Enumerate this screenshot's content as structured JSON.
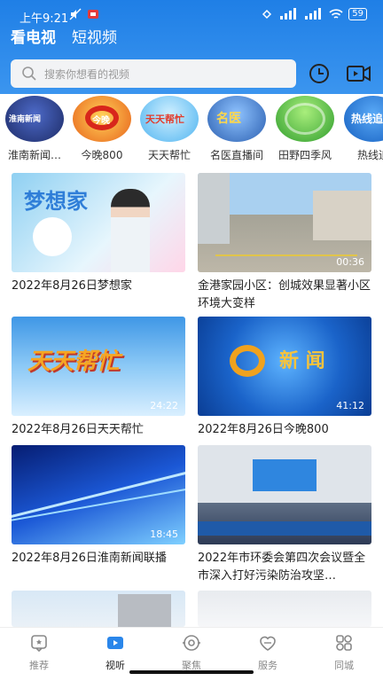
{
  "status_bar": {
    "time": "上午9:21",
    "battery": "59"
  },
  "main_tabs": [
    {
      "label": "看电视",
      "active": true
    },
    {
      "label": "短视频",
      "active": false
    }
  ],
  "search": {
    "placeholder": "搜索你想看的视频",
    "history_icon": "clock-icon",
    "video_icon": "video-camera-icon"
  },
  "channels": [
    {
      "name": "淮南新闻…",
      "logo_text": "淮南新闻",
      "bg": "#2b3a78"
    },
    {
      "name": "今晚800",
      "logo_text": "今晚",
      "bg": "#f07a1d"
    },
    {
      "name": "天天帮忙",
      "logo_text": "天天帮忙",
      "bg": "#4fb4f0"
    },
    {
      "name": "名医直播间",
      "logo_text": "名医",
      "bg": "#3d77c9"
    },
    {
      "name": "田野四季风",
      "logo_text": "",
      "bg": "#3fb13c"
    },
    {
      "name": "热线追",
      "logo_text": "热线追",
      "bg": "#1e76d8"
    }
  ],
  "videos": [
    {
      "title": "2022年8月26日梦想家",
      "duration": "",
      "bg1": "#9fd7f4",
      "bg2": "#e9f6fd",
      "overlay": "梦想家"
    },
    {
      "title": "金港家园小区：创城效果显著小区环境大变样",
      "duration": "00:36",
      "bg1": "#9fc6e8",
      "bg2": "#b9b3a6",
      "overlay": ""
    },
    {
      "title": "2022年8月26日天天帮忙",
      "duration": "24:22",
      "bg1": "#4ea4ea",
      "bg2": "#bfe2fb",
      "overlay": "天天帮忙"
    },
    {
      "title": "2022年8月26日今晚800",
      "duration": "41:12",
      "bg1": "#0d4fb8",
      "bg2": "#3c9af0",
      "overlay": "新 闻"
    },
    {
      "title": "2022年8月26日淮南新闻联播",
      "duration": "18:45",
      "bg1": "#0a2f9e",
      "bg2": "#4fa8ff",
      "overlay": ""
    },
    {
      "title": "2022年市环委会第四次会议暨全市深入打好污染防治攻坚…",
      "duration": "",
      "bg1": "#d7dde6",
      "bg2": "#1f5aa8",
      "overlay": ""
    },
    {
      "title": "",
      "duration": "",
      "bg1": "#cfe3f5",
      "bg2": "#e9eef3",
      "overlay": ""
    },
    {
      "title": "",
      "duration": "",
      "bg1": "#e6e9ee",
      "bg2": "#f4f5f7",
      "overlay": ""
    }
  ],
  "bottom_nav": [
    {
      "label": "推荐",
      "icon": "recommend-icon",
      "active": false
    },
    {
      "label": "视听",
      "icon": "play-icon",
      "active": true
    },
    {
      "label": "聚焦",
      "icon": "focus-icon",
      "active": false
    },
    {
      "label": "服务",
      "icon": "heart-service-icon",
      "active": false
    },
    {
      "label": "同城",
      "icon": "grid-city-icon",
      "active": false
    }
  ],
  "colors": {
    "accent": "#2a86ea",
    "active_nav": "#2a86ea"
  }
}
